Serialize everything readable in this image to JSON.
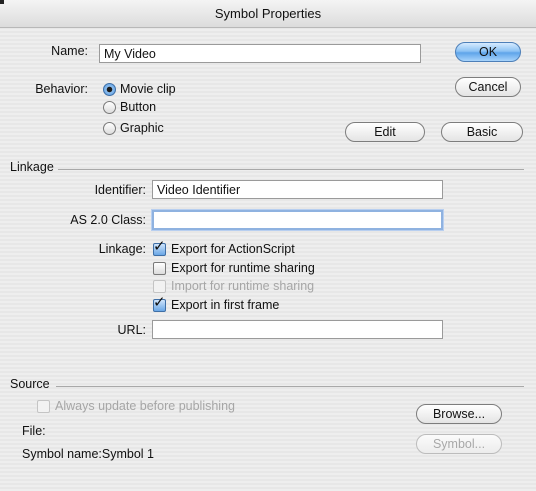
{
  "window": {
    "title": "Symbol Properties"
  },
  "symbol": {
    "name_label": "Name:",
    "name_value": "My Video",
    "behavior_label": "Behavior:",
    "behavior_options": [
      {
        "label": "Movie clip",
        "selected": true
      },
      {
        "label": "Button",
        "selected": false
      },
      {
        "label": "Graphic",
        "selected": false
      }
    ]
  },
  "buttons": {
    "ok": "OK",
    "cancel": "Cancel",
    "edit": "Edit",
    "basic": "Basic",
    "browse": "Browse...",
    "symbol": "Symbol..."
  },
  "linkage": {
    "section_title": "Linkage",
    "identifier_label": "Identifier:",
    "identifier_value": "Video Identifier",
    "as_class_label": "AS 2.0 Class:",
    "as_class_value": "",
    "linkage_label": "Linkage:",
    "options": [
      {
        "label": "Export for ActionScript",
        "checked": true,
        "enabled": true
      },
      {
        "label": "Export for runtime sharing",
        "checked": false,
        "enabled": true
      },
      {
        "label": "Import for runtime sharing",
        "checked": false,
        "enabled": false
      },
      {
        "label": "Export in first frame",
        "checked": true,
        "enabled": true
      }
    ],
    "url_label": "URL:",
    "url_value": ""
  },
  "source": {
    "section_title": "Source",
    "always_update_label": "Always update before publishing",
    "file_label": "File:",
    "symbol_name_text": "Symbol name:Symbol 1"
  },
  "colors": {
    "default_button": "#5ea4ea",
    "focus_ring": "#8fb2e0",
    "disabled_text": "#a6a6a6"
  }
}
